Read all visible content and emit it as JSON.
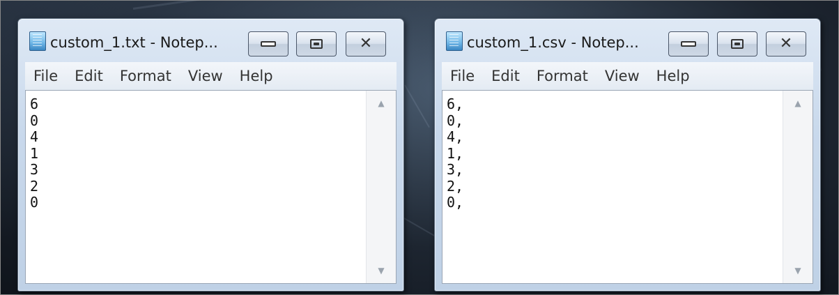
{
  "windows": [
    {
      "title": "custom_1.txt - Notep...",
      "menu": [
        "File",
        "Edit",
        "Format",
        "View",
        "Help"
      ],
      "content": "6\n0\n4\n1\n3\n2\n0",
      "buttons": {
        "close": "✕"
      },
      "scroll": {
        "up": "▲",
        "down": "▼"
      }
    },
    {
      "title": "custom_1.csv - Notep...",
      "menu": [
        "File",
        "Edit",
        "Format",
        "View",
        "Help"
      ],
      "content": "6,\n0,\n4,\n1,\n3,\n2,\n0,",
      "buttons": {
        "close": "✕"
      },
      "scroll": {
        "up": "▲",
        "down": "▼"
      }
    }
  ],
  "icons": {
    "app": "notepad-icon",
    "minimize": "minimize-icon",
    "maximize": "maximize-icon",
    "close": "close-icon"
  },
  "colors": {
    "desktop_bg": "#202833",
    "window_frame": "#c9d9ec",
    "editor_bg": "#ffffff"
  }
}
